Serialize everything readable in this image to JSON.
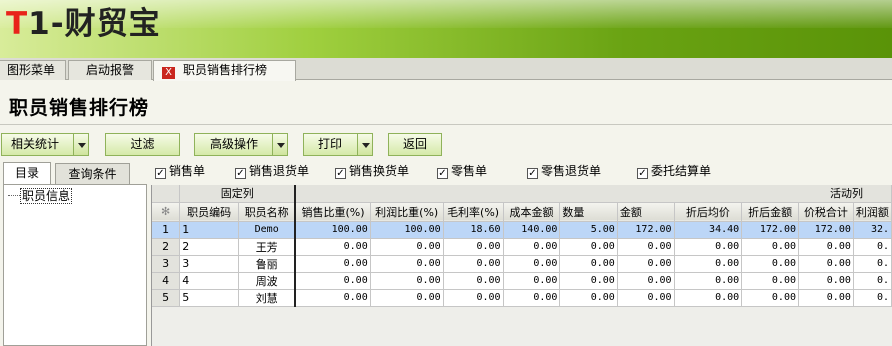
{
  "banner": {
    "logo_t": "T",
    "logo_rest": "1-财贸宝"
  },
  "tabs": [
    {
      "label": "图形菜单"
    },
    {
      "label": "启动报警"
    },
    {
      "label": "职员销售排行榜",
      "close": "X"
    }
  ],
  "page_title": "职员销售排行榜",
  "toolbar": {
    "related_stats": "相关统计",
    "filter": "过滤",
    "advanced": "高级操作",
    "print": "打印",
    "back": "返回"
  },
  "left_tabs": {
    "catalog": "目录",
    "query": "查询条件"
  },
  "tree": {
    "root": "职员信息"
  },
  "filters": [
    {
      "label": "销售单",
      "checked": true
    },
    {
      "label": "销售退货单",
      "checked": true
    },
    {
      "label": "销售换货单",
      "checked": true
    },
    {
      "label": "零售单",
      "checked": true
    },
    {
      "label": "零售退货单",
      "checked": true
    },
    {
      "label": "委托结算单",
      "checked": true
    }
  ],
  "grid": {
    "group_fixed": "固定列",
    "group_active": "活动列",
    "corner": "✻",
    "columns": [
      "职员编码",
      "职员名称",
      "销售比重(%)",
      "利润比重(%)",
      "毛利率(%)",
      "成本金额",
      "数量",
      "金额",
      "折后均价",
      "折后金额",
      "价税合计",
      "利润额"
    ],
    "rows": [
      {
        "n": "1",
        "code": "1",
        "name": "Demo",
        "v": [
          "100.00",
          "100.00",
          "18.60",
          "140.00",
          "5.00",
          "172.00",
          "34.40",
          "172.00",
          "172.00",
          "32."
        ]
      },
      {
        "n": "2",
        "code": "2",
        "name": "王芳",
        "v": [
          "0.00",
          "0.00",
          "0.00",
          "0.00",
          "0.00",
          "0.00",
          "0.00",
          "0.00",
          "0.00",
          "0."
        ]
      },
      {
        "n": "3",
        "code": "3",
        "name": "鲁丽",
        "v": [
          "0.00",
          "0.00",
          "0.00",
          "0.00",
          "0.00",
          "0.00",
          "0.00",
          "0.00",
          "0.00",
          "0."
        ]
      },
      {
        "n": "4",
        "code": "4",
        "name": "周波",
        "v": [
          "0.00",
          "0.00",
          "0.00",
          "0.00",
          "0.00",
          "0.00",
          "0.00",
          "0.00",
          "0.00",
          "0."
        ]
      },
      {
        "n": "5",
        "code": "5",
        "name": "刘慧",
        "v": [
          "0.00",
          "0.00",
          "0.00",
          "0.00",
          "0.00",
          "0.00",
          "0.00",
          "0.00",
          "0.00",
          "0."
        ]
      }
    ]
  },
  "colors": {
    "accent_green": "#6aa313",
    "selected_row": "#bcd6f7",
    "logo_red": "#e8231a"
  }
}
